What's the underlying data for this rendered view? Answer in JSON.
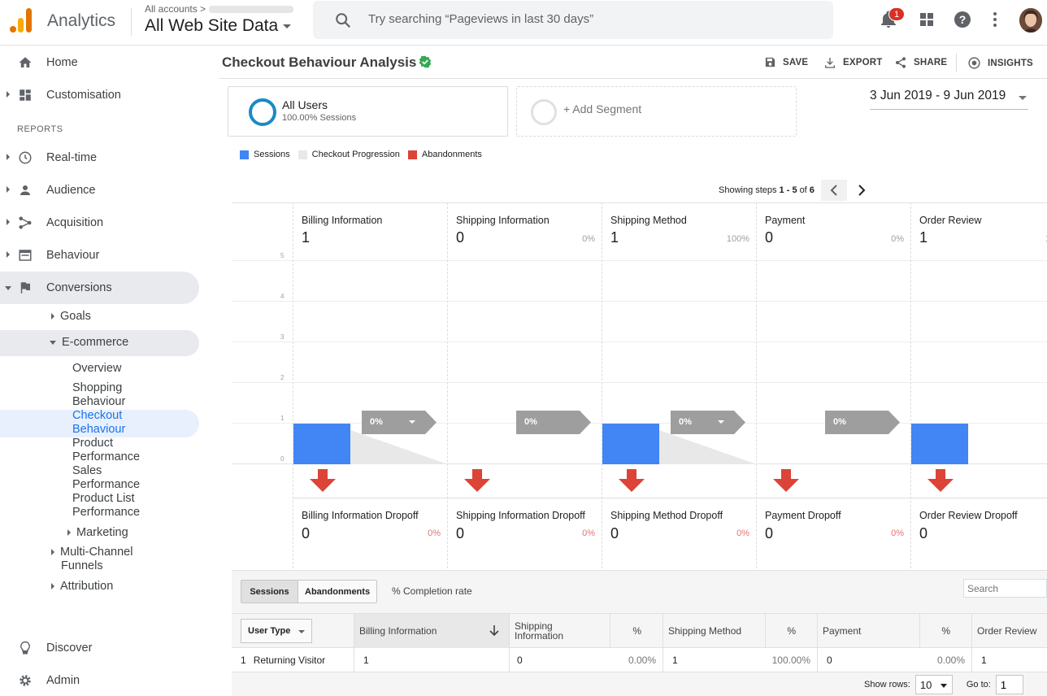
{
  "header": {
    "app_name": "Analytics",
    "account_crumb": "All accounts",
    "property": "All Web Site Data",
    "search_placeholder": "Try searching “Pageviews in last 30 days”",
    "notification_count": "1"
  },
  "sidebar": {
    "home": "Home",
    "customisation": "Customisation",
    "reports_heading": "REPORTS",
    "realtime": "Real-time",
    "audience": "Audience",
    "acquisition": "Acquisition",
    "behaviour": "Behaviour",
    "conversions": "Conversions",
    "goals": "Goals",
    "ecommerce": "E-commerce",
    "overview": "Overview",
    "shopping_behaviour_1": "Shopping",
    "shopping_behaviour_2": "Behaviour",
    "checkout_behaviour_1": "Checkout",
    "checkout_behaviour_2": "Behaviour",
    "product_performance_1": "Product",
    "product_performance_2": "Performance",
    "sales_performance_1": "Sales",
    "sales_performance_2": "Performance",
    "product_list_1": "Product List",
    "product_list_2": "Performance",
    "marketing": "Marketing",
    "mcf_1": "Multi-Channel",
    "mcf_2": "Funnels",
    "attribution": "Attribution",
    "discover": "Discover",
    "admin": "Admin"
  },
  "report": {
    "title": "Checkout Behaviour Analysis",
    "save": "SAVE",
    "export": "EXPORT",
    "share": "SHARE",
    "insights": "INSIGHTS",
    "segment_name": "All Users",
    "segment_sub": "100.00% Sessions",
    "add_segment": "+ Add Segment",
    "date_range": "3 Jun 2019 - 9 Jun 2019",
    "legend": [
      "Sessions",
      "Checkout Progression",
      "Abandonments"
    ],
    "steps_prefix": "Showing steps ",
    "steps_range": "1 - 5",
    "steps_of": " of ",
    "steps_total": "6",
    "y_ticks": [
      "5",
      "4",
      "3",
      "2",
      "1",
      "0"
    ]
  },
  "colors": {
    "sessions": "#4285f4",
    "progression": "#e8e8e8",
    "abandonments": "#db4437",
    "flag": "#9e9e9e"
  },
  "steps": [
    {
      "name": "Billing Information",
      "value": "1",
      "pct": "",
      "flag": "0%",
      "dropoff_name": "Billing Information Dropoff",
      "dropoff_value": "0",
      "dropoff_pct": "0%"
    },
    {
      "name": "Shipping Information",
      "value": "0",
      "pct": "0%",
      "flag": "0%",
      "dropoff_name": "Shipping Information Dropoff",
      "dropoff_value": "0",
      "dropoff_pct": "0%"
    },
    {
      "name": "Shipping Method",
      "value": "1",
      "pct": "100%",
      "flag": "0%",
      "dropoff_name": "Shipping Method Dropoff",
      "dropoff_value": "0",
      "dropoff_pct": "0%"
    },
    {
      "name": "Payment",
      "value": "0",
      "pct": "0%",
      "flag": "0%",
      "dropoff_name": "Payment Dropoff",
      "dropoff_value": "0",
      "dropoff_pct": "0%"
    },
    {
      "name": "Order Review",
      "value": "1",
      "pct": "1",
      "flag": "",
      "dropoff_name": "Order Review Dropoff",
      "dropoff_value": "0",
      "dropoff_pct": ""
    }
  ],
  "table": {
    "tab_sessions": "Sessions",
    "tab_abandonments": "Abandonments",
    "completion_rate": "% Completion rate",
    "search_placeholder": "Search",
    "dimension": "User Type",
    "columns": [
      "Billing Information",
      "Shipping Information",
      "%",
      "Shipping Method",
      "%",
      "Payment",
      "%",
      "Order Review"
    ],
    "row": {
      "index": "1",
      "user_type": "Returning Visitor",
      "billing": "1",
      "shipping_info": "0",
      "shipping_info_pct": "0.00%",
      "shipping_method": "1",
      "shipping_method_pct": "100.00%",
      "payment": "0",
      "payment_pct": "0.00%",
      "order_review": "1"
    },
    "show_rows_label": "Show rows:",
    "show_rows_value": "10",
    "goto_label": "Go to:",
    "goto_value": "1"
  }
}
